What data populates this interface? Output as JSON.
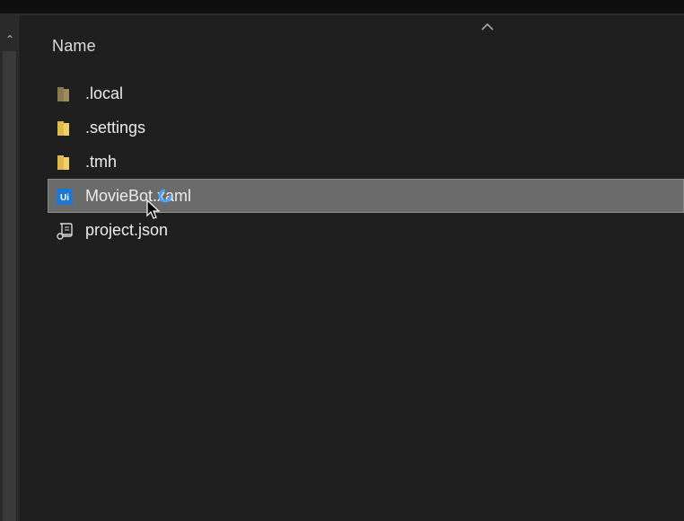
{
  "header": {
    "name_column": "Name"
  },
  "files": [
    {
      "name": ".local",
      "type": "folder",
      "icon": "folder-icon",
      "color": "#8a7a52"
    },
    {
      "name": ".settings",
      "type": "folder",
      "icon": "folder-icon",
      "color": "#e8c35a"
    },
    {
      "name": ".tmh",
      "type": "folder",
      "icon": "folder-icon",
      "color": "#e8c35a"
    },
    {
      "name": "MovieBot.xaml",
      "type": "xaml",
      "icon": "uipath-xaml-icon",
      "color": "#1e78d2",
      "selected": true
    },
    {
      "name": "project.json",
      "type": "json",
      "icon": "json-script-icon",
      "color": "#d8d8d8"
    }
  ],
  "colors": {
    "background": "#1f1f1f",
    "selection": "#6b6b6b",
    "text": "#ececec"
  }
}
